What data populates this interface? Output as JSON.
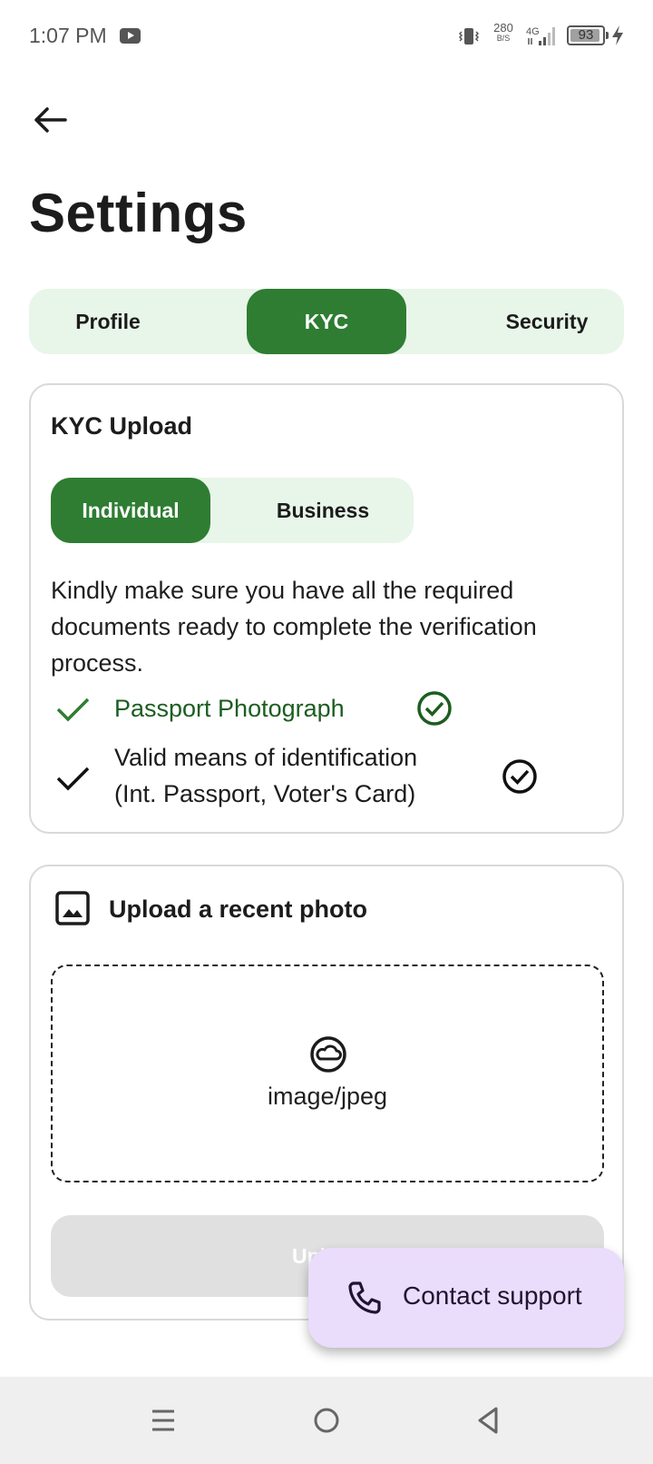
{
  "status_bar": {
    "time": "1:07 PM",
    "net_speed": "280",
    "net_speed_unit": "B/S",
    "battery_level": "93",
    "battery_fraction": 0.93
  },
  "header": {
    "title": "Settings"
  },
  "tabs": [
    {
      "label": "Profile"
    },
    {
      "label": "KYC",
      "selected": true
    },
    {
      "label": "Security"
    }
  ],
  "kyc_card": {
    "title": "KYC Upload",
    "segments": [
      {
        "label": "Individual",
        "selected": true
      },
      {
        "label": "Business"
      }
    ],
    "instruction": "Kindly make sure you have all the required documents ready to complete the verification process.",
    "requirements": [
      {
        "label": "Passport Photograph",
        "completed": true
      },
      {
        "label": "Valid means of identification (Int. Passport, Voter's Card)",
        "completed": true
      }
    ]
  },
  "upload_card": {
    "title": "Upload a recent photo",
    "accepted_type": "image/jpeg",
    "button_label": "Upload"
  },
  "fab": {
    "label": "Contact support"
  },
  "colors": {
    "primary": "#2e7d32",
    "primary_light": "#e8f5e9",
    "success_text": "#1b5e20",
    "fab_bg": "#eadcfb",
    "disabled": "#e0e0e0"
  },
  "icons": {
    "back": "arrow-left-icon",
    "requirement_check": "check-icon",
    "requirement_done": "check-circle-icon",
    "upload_header": "image-icon",
    "dropzone": "cloud-icon",
    "fab": "phone-icon"
  }
}
